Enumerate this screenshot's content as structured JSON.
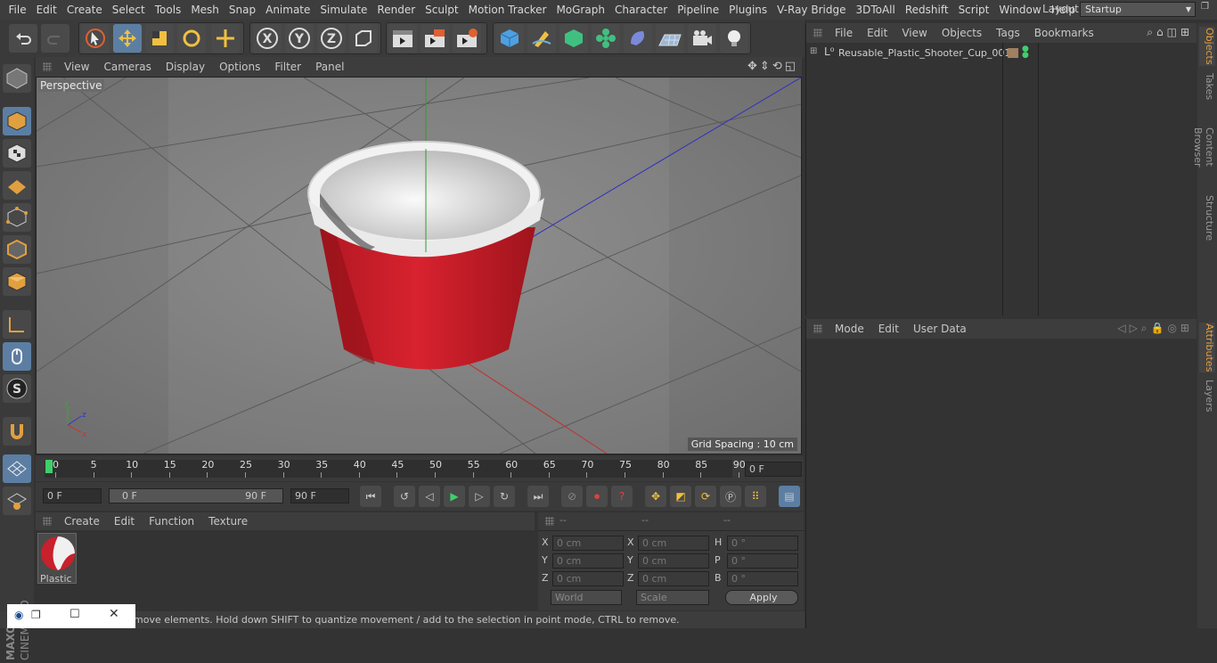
{
  "menu": [
    "File",
    "Edit",
    "Create",
    "Select",
    "Tools",
    "Mesh",
    "Snap",
    "Animate",
    "Simulate",
    "Render",
    "Sculpt",
    "Motion Tracker",
    "MoGraph",
    "Character",
    "Pipeline",
    "Plugins",
    "V-Ray Bridge",
    "3DToAll",
    "Redshift",
    "Script",
    "Window",
    "Help"
  ],
  "layout": {
    "label": "Layout:",
    "value": "Startup"
  },
  "viewport": {
    "menu": [
      "View",
      "Cameras",
      "Display",
      "Options",
      "Filter",
      "Panel"
    ],
    "label": "Perspective",
    "grid_spacing": "Grid Spacing : 10 cm",
    "axis_x": "x",
    "axis_y": "y",
    "axis_z": "z"
  },
  "timeline": {
    "ticks": [
      "0",
      "5",
      "10",
      "15",
      "20",
      "25",
      "30",
      "35",
      "40",
      "45",
      "50",
      "55",
      "60",
      "65",
      "70",
      "75",
      "80",
      "85",
      "90"
    ],
    "current_frame": "0 F"
  },
  "playback": {
    "start": "0 F",
    "range_start": "0 F",
    "range_end": "90 F",
    "end": "90 F"
  },
  "material": {
    "menu": [
      "Create",
      "Edit",
      "Function",
      "Texture"
    ],
    "name": "Plastic"
  },
  "coords": {
    "headers": [
      "--",
      "--",
      "--"
    ],
    "rows": [
      {
        "a": "X",
        "av": "0 cm",
        "b": "X",
        "bv": "0 cm",
        "c": "H",
        "cv": "0 °"
      },
      {
        "a": "Y",
        "av": "0 cm",
        "b": "Y",
        "bv": "0 cm",
        "c": "P",
        "cv": "0 °"
      },
      {
        "a": "Z",
        "av": "0 cm",
        "b": "Z",
        "bv": "0 cm",
        "c": "B",
        "cv": "0 °"
      }
    ],
    "world": "World",
    "scale": "Scale",
    "apply": "Apply"
  },
  "objects": {
    "menu": [
      "File",
      "Edit",
      "View",
      "Objects",
      "Tags",
      "Bookmarks"
    ],
    "item": "Reusable_Plastic_Shooter_Cup_001"
  },
  "attributes": {
    "menu": [
      "Mode",
      "Edit",
      "User Data"
    ]
  },
  "sidetabs": [
    "Objects",
    "Takes",
    "Content Browser",
    "Structure",
    "Attributes",
    "Layers"
  ],
  "status": "move elements. Hold down SHIFT to quantize movement / add to the selection in point mode, CTRL to remove.",
  "brand": {
    "maxon": "MAXON",
    "product": "CINEMA 4D"
  },
  "colors": {
    "accent": "#5c7ea3",
    "cup_red": "#c8202c",
    "active_tab": "#e8a040"
  }
}
